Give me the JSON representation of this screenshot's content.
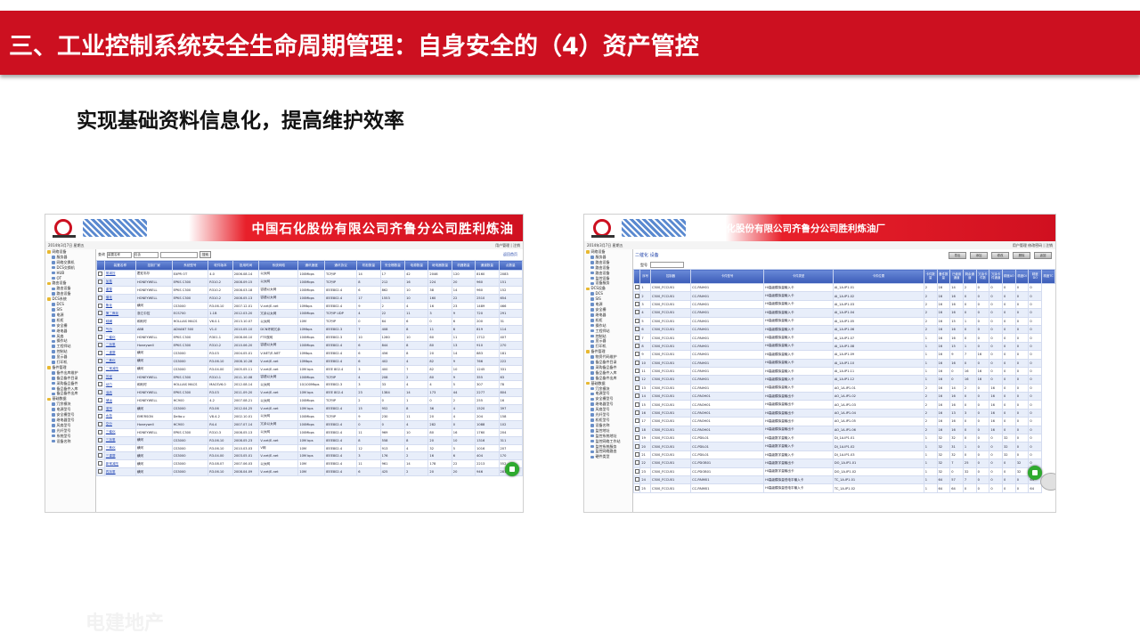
{
  "slide": {
    "title": "三、工业控制系统安全生命周期管理：自身安全的（4）资产管控",
    "subtitle": "实现基础资料信息化，提高维护效率",
    "watermark": "电建地产"
  },
  "colors": {
    "title_bar": "#cc1020",
    "table_header": "#3b5cb8",
    "alt_row": "#e8eefa"
  },
  "left_screenshot": {
    "banner_title": "中国石化股份有限公司齐鲁分公司胜利炼油",
    "info_left": "2014年3月7日  星期五",
    "info_right": "用户管理  | 注销",
    "toolbar": {
      "search_label": "查询",
      "select_value": "装置名称",
      "match_value": "包含",
      "search_button": "搜索",
      "export_link": "返回首页"
    },
    "sidebar": [
      "网络设备",
      "服务器",
      "网络交换机",
      "DCS交换机",
      "HUB",
      "OT",
      "路由设备",
      "路由设备",
      "路由设备",
      "DCS系统",
      "DCS",
      "SIS",
      "电源",
      "机柜",
      "安全栅",
      "继电器",
      "风扇",
      "操作站",
      "工程师站",
      "控制站",
      "显示器",
      "打印机",
      "备件管理",
      "备件出库维护",
      "备品备件目录",
      "采购备品备件",
      "备品备件入库",
      "备品备件出库",
      "基础数据",
      "冗余模块",
      "电源型号",
      "安全栅型号",
      "继电器型号",
      "风扇型号",
      "光纤型号",
      "系统型号",
      "设备名称"
    ],
    "columns": [
      "",
      "装置名称",
      "控制厂家",
      "系统型号",
      "软件版本",
      "投用时间",
      "系统网络",
      "通讯速度",
      "通讯协议",
      "机柜数量",
      "安全栅数量",
      "电源数量",
      "继电器数量",
      "机器数量",
      "通道数量",
      "点数量"
    ],
    "rows": [
      [
        "常减压",
        "霍尼韦尔",
        "EXPR OT",
        "4.0",
        "2006.08.14",
        "以太网",
        "100Mbps",
        "TCP/IP",
        "14",
        "17",
        "42",
        "2046",
        "120",
        "8160",
        "2083"
      ],
      [
        "加氢",
        "HONEYWELL",
        "EPKS C300",
        "R310.2",
        "2008.09.15",
        "以太网",
        "100Mbps",
        "TCP/IP",
        "8",
        "212",
        "16",
        "224",
        "20",
        "960",
        "151"
      ],
      [
        "重整",
        "HONEYWELL",
        "EPKS C300",
        "R310.2",
        "2008.03.18",
        "容错以太网",
        "100Mbps",
        "IEEE802.4",
        "6",
        "862",
        "10",
        "38",
        "14",
        "960",
        "152"
      ],
      [
        "催化",
        "HONEYWELL",
        "EPKS C300",
        "R310.2",
        "2008.05.13",
        "容错以太网",
        "100Mbps",
        "IEEE802.4",
        "17",
        "1553",
        "10",
        "160",
        "22",
        "2510",
        "654"
      ],
      [
        "焦化",
        "横河",
        "CS3000",
        "R3.06.10",
        "2007.12.01",
        "V-net/E-net",
        "10Mbps",
        "IEEE802.4",
        "9",
        "2",
        "4",
        "16",
        "23",
        "1489",
        "466"
      ],
      [
        "第二焦化",
        "浙江中控",
        "ECS700",
        "1.1B",
        "2012.03.20",
        "冗余以太网",
        "100Mbps",
        "TCP/IP UDP",
        "4",
        "22",
        "11",
        "3",
        "9",
        "720",
        "291"
      ],
      [
        "硫磺",
        "和利时",
        "HOLLIAS MACS",
        "V6.0.1",
        "2013.10.07",
        "以太网",
        "10M",
        "TCP/IP",
        "0",
        "64",
        "6",
        "0",
        "6",
        "200",
        "31"
      ],
      [
        "气分",
        "ABB",
        "ADVANT 500",
        "V1.0",
        "2010.05.10",
        "DCN环网冗余",
        "10Mbps",
        "IEEE802.3",
        "7",
        "408",
        "8",
        "11",
        "6",
        "819",
        "114"
      ],
      [
        "二催化",
        "HONEYWELL",
        "EPKS C300",
        "R301.1",
        "2008.06.10",
        "FTE双网",
        "100Mbps",
        "IEEE802.3",
        "10",
        "1280",
        "10",
        "60",
        "11",
        "1712",
        "407"
      ],
      [
        "二加氢",
        "Honeywell",
        "EPKS C300",
        "R310.2",
        "2010.06.20",
        "容错以太网",
        "100Mbps",
        "IEEE802.4",
        "6",
        "844",
        "8",
        "80",
        "13",
        "910",
        "270"
      ],
      [
        "二重整",
        "横河",
        "CS3000",
        "R3.03",
        "2004.05.01",
        "V-NET/E-NET",
        "10Mbps",
        "IEEE802.4",
        "6",
        "456",
        "8",
        "20",
        "14",
        "883",
        "181"
      ],
      [
        "二焦化",
        "横河",
        "CS3000",
        "R3.06.10",
        "2008.10.28",
        "V-net/E-net",
        "10Mbps",
        "IEEE802.4",
        "6",
        "402",
        "4",
        "82",
        "9",
        "766",
        "222"
      ],
      [
        "二常减压",
        "横河",
        "CS3000",
        "R3.04.00",
        "2005.05.11",
        "V-net/E-net",
        "10M bps",
        "IEEE 802.4",
        "3",
        "400",
        "7",
        "82",
        "10",
        "1245",
        "331"
      ],
      [
        "芳烃",
        "HONEYWELL",
        "EPKS C300",
        "R310.1",
        "2011.10.08",
        "容错以太网",
        "100Mbps",
        "TCP/IP",
        "4",
        "208",
        "2",
        "80",
        "9",
        "355",
        "63"
      ],
      [
        "动力",
        "和利时",
        "HOLLIAS MACS",
        "MACSV6.0",
        "2012.08.14",
        "以太网",
        "10/100Mbps",
        "IEEE802.3",
        "3",
        "33",
        "4",
        "4",
        "5",
        "307",
        "78"
      ],
      [
        "油品",
        "HONEYWELL",
        "EPKS C300",
        "R3.03",
        "2011.09.20",
        "V-net/E-net",
        "10M bps",
        "IEEE 802.4",
        "23",
        "1384",
        "14",
        "173",
        "44",
        "2277",
        "804"
      ],
      [
        "储运",
        "HONEYWELL",
        "HC900",
        "4.2",
        "2007.08.21",
        "以太网",
        "100Mbps",
        "TCP/IP",
        "2",
        "0",
        "1",
        "0",
        "2",
        "255",
        "16"
      ],
      [
        "溶剂",
        "横河",
        "CS3000",
        "R3.06",
        "2012.04.25",
        "V-net/E-net",
        "10M bps",
        "IEEE802.4",
        "15",
        "952",
        "8",
        "36",
        "4",
        "1520",
        "397"
      ],
      [
        "水务",
        "EMERSON",
        "Delta-v",
        "V8.4.2",
        "2002.10.01",
        "以太网",
        "100Mbps",
        "TCP/IP",
        "9",
        "230",
        "11",
        "20",
        "4",
        "204",
        "158"
      ],
      [
        "空分",
        "Honeywell",
        "HC900",
        "R4.4",
        "2007.07.14",
        "冗余以太网",
        "100Mbps",
        "IEEE802.4",
        "0",
        "0",
        "4",
        "282",
        "0",
        "1088",
        "102"
      ],
      [
        "三催化",
        "HONEYWELL",
        "EPKS C300",
        "R310.3",
        "2008.05.13",
        "以太网",
        "100Mbps",
        "IEEE802.4",
        "11",
        "969",
        "10",
        "80",
        "16",
        "1760",
        "204"
      ],
      [
        "三加氢",
        "横河",
        "CS3000",
        "R3.06.10",
        "2008.05.23",
        "V-net/E-net",
        "10M bps",
        "IEEE802.4",
        "8",
        "558",
        "8",
        "20",
        "10",
        "1316",
        "311"
      ],
      [
        "三焦化",
        "横河",
        "CS3000",
        "R3.06.10",
        "2010.03.03",
        "V网",
        "10M",
        "IEEE802.4",
        "12",
        "913",
        "4",
        "32",
        "5",
        "1016",
        "207"
      ],
      [
        "三重整",
        "横河",
        "CS3000",
        "R3.04.00",
        "2003.05.01",
        "V-net/E-net",
        "10M bps",
        "IEEE802.4",
        "3",
        "176",
        "2",
        "16",
        "6",
        "404",
        "170"
      ],
      [
        "新常减压",
        "横河",
        "CS3000",
        "R3.08.07",
        "2007.06.03",
        "以太网",
        "10M",
        "IEEE802.4",
        "11",
        "961",
        "14",
        "178",
        "22",
        "2213",
        "552"
      ],
      [
        "四加氢",
        "横河",
        "CS3000",
        "R3.06.10",
        "2008.04.09",
        "V-net/E-net",
        "10M",
        "IEEE802.4",
        "6",
        "425",
        "2",
        "20",
        "20",
        "946",
        "281"
      ]
    ]
  },
  "right_screenshot": {
    "banner_title": "中国石化股份有限公司齐鲁分公司胜利炼油厂",
    "info_left": "2014年3月7日  星期五",
    "info_right": "用户管理  修改密码  | 注销",
    "header_title": "二催化 设备",
    "header_buttons": [
      "导出",
      "添加",
      "修改",
      "删除",
      "返回"
    ],
    "filter_label": "型号",
    "sidebar": [
      "网络设备",
      "服务器",
      "路由设备",
      "路由设备",
      "路由设备",
      "监控设备",
      "设备服务",
      "DCS设备",
      "DCS",
      "SIS",
      "电源",
      "安全栅",
      "继电器",
      "机柜",
      "操作站",
      "工程师站",
      "控制站",
      "显示器",
      "打印机",
      "备件管理",
      "物资代码维护",
      "备品备件目录",
      "采购备品备件",
      "备品备件入库",
      "备品备件出库",
      "基础数据",
      "冗余模块",
      "电源型号",
      "安全栅型号",
      "继电器型号",
      "风扇型号",
      "光纤型号",
      "机柜型号",
      "设备名称",
      "监控地址",
      "监控系统地址",
      "监控网络工作站",
      "监控系统服务",
      "监控网络路由",
      "硬件类型"
    ],
    "columns": [
      "",
      "序号",
      "控制器",
      "卡件型号",
      "卡件类型",
      "卡件位置",
      "卡件数量",
      "备件数量",
      "已使用通道",
      "剩余通道",
      "冗余卡件数",
      "冗余卡件通道",
      "精度AO",
      "精度DI",
      "精度DO",
      "精度TC"
    ],
    "rows": [
      [
        "1",
        "C300_FCCU01",
        "CC-PAIH01",
        "HI高级模拟量输入卡",
        "AI_1A.IP1.01",
        "2",
        "16",
        "14",
        "2",
        "0",
        "0",
        "0",
        "0",
        "0"
      ],
      [
        "2",
        "C300_FCCU01",
        "CC-PAIH01",
        "HI高级模拟量输入卡",
        "AI_1A.IP1.02",
        "2",
        "16",
        "16",
        "0",
        "0",
        "0",
        "0",
        "0",
        "0"
      ],
      [
        "3",
        "C300_FCCU01",
        "CC-PAIH01",
        "HI高级模拟量输入卡",
        "AI_1A.IP1.03",
        "2",
        "16",
        "16",
        "0",
        "0",
        "0",
        "0",
        "0",
        "0"
      ],
      [
        "4",
        "C300_FCCU01",
        "CC-PAIH01",
        "HI高级模拟量输入卡",
        "AI_1A.IP1.04",
        "2",
        "16",
        "16",
        "0",
        "0",
        "0",
        "0",
        "0",
        "0"
      ],
      [
        "5",
        "C300_FCCU01",
        "CC-PAIH01",
        "HI高级模拟量输入卡",
        "AI_1A.IP1.05",
        "2",
        "16",
        "15",
        "1",
        "0",
        "0",
        "0",
        "0",
        "0"
      ],
      [
        "6",
        "C300_FCCU01",
        "CC-PAIH01",
        "HI高级模拟量输入卡",
        "AI_1A.IP1.06",
        "2",
        "16",
        "16",
        "0",
        "0",
        "0",
        "0",
        "0",
        "0"
      ],
      [
        "7",
        "C300_FCCU01",
        "CC-PAIH01",
        "HI高级模拟量输入卡",
        "AI_1A.IP1.07",
        "1",
        "16",
        "16",
        "0",
        "0",
        "0",
        "0",
        "0",
        "0"
      ],
      [
        "8",
        "C300_FCCU01",
        "CC-PAIH01",
        "HI高级模拟量输入卡",
        "AI_1A.IP1.08",
        "1",
        "16",
        "15",
        "1",
        "0",
        "0",
        "0",
        "0",
        "0"
      ],
      [
        "9",
        "C300_FCCU01",
        "CC-PAIH01",
        "HI高级模拟量输入卡",
        "AI_1A.IP1.09",
        "1",
        "16",
        "9",
        "7",
        "16",
        "0",
        "0",
        "0",
        "0"
      ],
      [
        "10",
        "C300_FCCU01",
        "CC-PAIH01",
        "HI高级模拟量输入卡",
        "AI_1A.IP1.10",
        "1",
        "16",
        "16",
        "0",
        "0",
        "0",
        "0",
        "0",
        "0"
      ],
      [
        "11",
        "C300_FCCU01",
        "CC-PAIH01",
        "HI高级模拟量输入卡",
        "AI_1A.IP1.11",
        "1",
        "16",
        "0",
        "16",
        "16",
        "0",
        "0",
        "0",
        "0"
      ],
      [
        "12",
        "C300_FCCU01",
        "CC-PAIH01",
        "HI高级模拟量输入卡",
        "AI_1A.IP1.12",
        "1",
        "16",
        "0",
        "16",
        "16",
        "0",
        "0",
        "0",
        "0"
      ],
      [
        "13",
        "C300_FCCU01",
        "CC-PAIH01",
        "HI高级模拟量输入卡",
        "AO_1A.IP1.01",
        "2",
        "16",
        "14",
        "2",
        "0",
        "16",
        "0",
        "0",
        "0"
      ],
      [
        "14",
        "C300_FCCU01",
        "CC-PAOH01",
        "HI高级模拟量输出卡",
        "AO_1A.IP1.02",
        "2",
        "16",
        "16",
        "0",
        "0",
        "16",
        "0",
        "0",
        "0"
      ],
      [
        "15",
        "C300_FCCU01",
        "CC-PAOH01",
        "HI高级模拟量输出卡",
        "AO_1A.IP1.03",
        "2",
        "16",
        "16",
        "0",
        "0",
        "16",
        "0",
        "0",
        "0"
      ],
      [
        "16",
        "C300_FCCU01",
        "CC-PAOH01",
        "HI高级模拟量输出卡",
        "AO_1A.IP1.04",
        "2",
        "16",
        "13",
        "3",
        "0",
        "16",
        "0",
        "0",
        "0"
      ],
      [
        "17",
        "C300_FCCU01",
        "CC-PAOH01",
        "HI高级模拟量输出卡",
        "AO_1A.IP1.05",
        "2",
        "16",
        "16",
        "0",
        "0",
        "16",
        "0",
        "0",
        "0"
      ],
      [
        "18",
        "C300_FCCU01",
        "CC-PAOH01",
        "HI高级模拟量输出卡",
        "AO_1A.IP1.06",
        "2",
        "16",
        "16",
        "0",
        "0",
        "16",
        "0",
        "0",
        "0"
      ],
      [
        "19",
        "C300_FCCU01",
        "CC-PDIL01",
        "HI高级数字量输入卡",
        "DI_1A.IP1.01",
        "1",
        "32",
        "32",
        "0",
        "0",
        "0",
        "32",
        "0",
        "0"
      ],
      [
        "20",
        "C300_FCCU01",
        "CC-PDIL01",
        "HI高级数字量输入卡",
        "DI_1A.IP1.02",
        "1",
        "32",
        "31",
        "1",
        "0",
        "0",
        "32",
        "0",
        "0"
      ],
      [
        "21",
        "C300_FCCU01",
        "CC-PDIL01",
        "HI高级数字量输入卡",
        "DI_1A.IP1.03",
        "1",
        "32",
        "32",
        "0",
        "0",
        "0",
        "32",
        "0",
        "0"
      ],
      [
        "22",
        "C300_FCCU01",
        "CC-PDOB01",
        "HI高级数字量输出卡",
        "DO_1A.IP1.01",
        "1",
        "32",
        "7",
        "25",
        "0",
        "0",
        "0",
        "32",
        "0"
      ],
      [
        "23",
        "C300_FCCU01",
        "CC-PDOB01",
        "HI高级数字量输出卡",
        "DO_1A.IP1.02",
        "1",
        "32",
        "0",
        "32",
        "0",
        "0",
        "0",
        "32",
        "0"
      ],
      [
        "24",
        "C300_FCCU01",
        "CC-PAIM01",
        "HI高级模拟量低电平输入卡",
        "TC_1A.IP1.01",
        "1",
        "64",
        "57",
        "7",
        "0",
        "0",
        "0",
        "0",
        "64"
      ],
      [
        "25",
        "C300_FCCU01",
        "CC-PAIM01",
        "HI高级模拟量低电平输入卡",
        "TC_1A.IP1.02",
        "1",
        "64",
        "64",
        "0",
        "0",
        "0",
        "0",
        "0",
        "64"
      ]
    ]
  }
}
